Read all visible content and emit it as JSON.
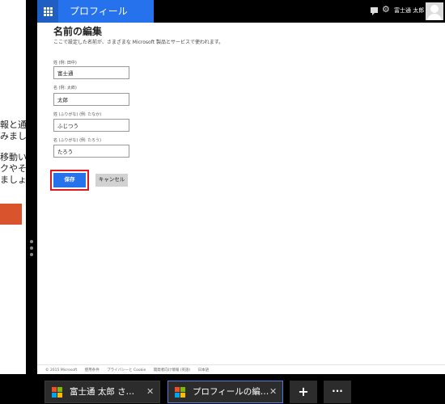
{
  "left_pane": {
    "lines": [
      "報と通知",
      "みましょ",
      "移動い",
      "クやそ",
      "ましょう"
    ]
  },
  "header": {
    "title": "プロフィール",
    "user_name": "富士通 太郎",
    "apps_icon": "grid-icon",
    "chat_icon": "chat-icon",
    "settings_icon": "gear-icon"
  },
  "page": {
    "title": "名前の編集",
    "description": "ここで設定した名前が、さまざまな Microsoft 製品とサービスで使われます。"
  },
  "form": {
    "fields": [
      {
        "label": "姓 (例: 田中)",
        "value": "富士通"
      },
      {
        "label": "名 (例: 太郎)",
        "value": "太郎"
      },
      {
        "label": "姓 (ふりがな) (例: たなか)",
        "value": "ふじつう"
      },
      {
        "label": "名 (ふりがな) (例: たろう)",
        "value": "たろう"
      }
    ],
    "save_label": "保存",
    "cancel_label": "キャンセル"
  },
  "footer": {
    "copyright": "© 2015 Microsoft",
    "links": [
      "使用条件",
      "プライバシーと Cookie",
      "開発者向け情報 (英語)",
      "日本語"
    ]
  },
  "tabs": [
    {
      "label": "富士通 太郎 さ…",
      "active": false
    },
    {
      "label": "プロフィールの編…",
      "active": true
    }
  ],
  "tab_actions": {
    "new_tab": "+",
    "more": "···"
  },
  "colors": {
    "accent": "#2672ec",
    "highlight_box": "#e0161c",
    "left_accent": "#d9532c"
  }
}
